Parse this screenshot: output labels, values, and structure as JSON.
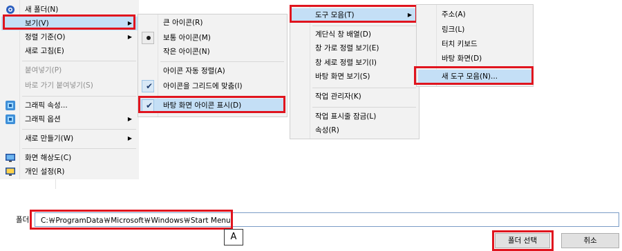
{
  "desktop_menu": {
    "new_folder": "새 폴더(N)",
    "view": "보기(V)",
    "sort_by": "정렬 기준(O)",
    "refresh": "새로 고침(E)",
    "paste": "붙여넣기(P)",
    "paste_shortcut": "바로 가기 붙여넣기(S)",
    "graphics_properties": "그래픽 속성...",
    "graphics_options": "그래픽 옵션",
    "new": "새로 만들기(W)",
    "screen_resolution": "화면 해상도(C)",
    "personalize": "개인 설정(R)"
  },
  "view_submenu": {
    "large_icons": "큰 아이콘(R)",
    "medium_icons": "보통 아이콘(M)",
    "small_icons": "작은 아이콘(N)",
    "auto_arrange": "아이콘 자동 정렬(A)",
    "align_to_grid": "아이콘을 그리드에 맞춤(I)",
    "show_desktop_icons": "바탕 화면 아이콘 표시(D)"
  },
  "taskbar_menu": {
    "toolbars": "도구 모음(T)",
    "cascade": "계단식 창 배열(D)",
    "stacked": "창 가로 정렬 보기(E)",
    "side_by_side": "창 세로 정렬 보기(I)",
    "show_desktop": "바탕 화면 보기(S)",
    "task_manager": "작업 관리자(K)",
    "lock_taskbar": "작업 표시줄 잠금(L)",
    "properties": "속성(R)"
  },
  "toolbar_submenu": {
    "address": "주소(A)",
    "links": "링크(L)",
    "touch_keyboard": "터치 키보드",
    "desktop": "바탕 화면(D)",
    "new_toolbar": "새 도구 모음(N)..."
  },
  "folder_dialog": {
    "label": "폴더",
    "path": "C:￦ProgramData￦Microsoft￦Windows￦Start Menu",
    "annotation": "A",
    "select_folder": "폴더 선택",
    "cancel": "취소"
  },
  "colors": {
    "highlight_box": "#e0141e",
    "hover": "#c4dff6"
  }
}
